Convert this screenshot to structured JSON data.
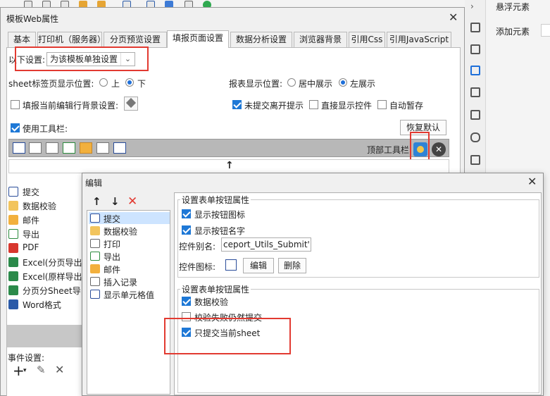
{
  "background": {
    "right_panel": {
      "floating": "悬浮元素",
      "add": "添加元素"
    }
  },
  "dialog": {
    "title": "模板Web属性",
    "tabs": [
      "基本",
      "打印机（服务器）",
      "分页预览设置",
      "填报页面设置",
      "数据分析设置",
      "浏览器背景",
      "引用Css",
      "引用JavaScript"
    ],
    "active_tab": 3,
    "setting_label": "以下设置:",
    "setting_value": "为该模板单独设置",
    "sheet_label": "sheet标签页显示位置:",
    "sheet_up": "上",
    "sheet_down": "下",
    "report_pos_label": "报表显示位置:",
    "report_center": "居中展示",
    "report_left": "左展示",
    "fill_bg": "填报当前编辑行背景设置:",
    "unsubmitted": "未提交离开提示",
    "direct_show": "直接显示控件",
    "auto_save": "自动暂存",
    "use_toolbar": "使用工具栏:",
    "restore": "恢复默认",
    "top_toolbar": "顶部工具栏",
    "up_arrow": "↑",
    "list": [
      "提交",
      "数据校验",
      "邮件",
      "导出",
      "PDF",
      "Excel(分页导出",
      "Excel(原样导出",
      "分页分Sheet导出",
      "Word格式"
    ],
    "event_label": "事件设置:"
  },
  "edit_dialog": {
    "title": "编辑",
    "items": [
      "提交",
      "数据校验",
      "打印",
      "导出",
      "邮件",
      "插入记录",
      "显示单元格值"
    ],
    "group1_title": "设置表单按钮属性",
    "show_icon": "显示按钮图标",
    "show_name": "显示按钮名字",
    "alias_label": "控件别名:",
    "alias_value": "ceport_Utils_Submit')}",
    "icon_label": "控件图标:",
    "edit_btn": "编辑",
    "delete_btn": "删除",
    "group2_title": "设置表单按钮属性",
    "data_check": "数据校验",
    "check_fail": "校验失败仍然提交",
    "only_current": "只提交当前sheet"
  },
  "colors": {
    "accent": "#1e78d6",
    "highlight": "#e23a31"
  }
}
